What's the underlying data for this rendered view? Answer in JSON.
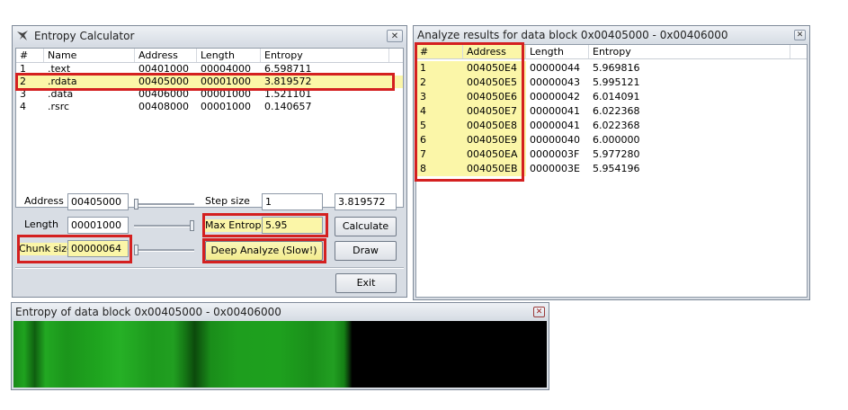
{
  "entropy_window": {
    "title": "Entropy Calculator",
    "close_label": "✕",
    "columns": [
      "#",
      "Name",
      "Address",
      "Length",
      "Entropy"
    ],
    "rows": [
      [
        "1",
        ".text",
        "00401000",
        "00004000",
        "6.598711"
      ],
      [
        "2",
        ".rdata",
        "00405000",
        "00001000",
        "3.819572"
      ],
      [
        "3",
        ".data",
        "00406000",
        "00001000",
        "1.521101"
      ],
      [
        "4",
        ".rsrc",
        "00408000",
        "00001000",
        "0.140657"
      ]
    ],
    "selected_row": 1,
    "address_label": "Address",
    "address_value": "00405000",
    "length_label": "Length",
    "length_value": "00001000",
    "chunk_label": "Chunk size",
    "chunk_value": "00000064",
    "step_label": "Step size",
    "step_value": "1",
    "result_value": "3.819572",
    "max_entropy_label": "Max Entropy",
    "max_entropy_value": "5.95",
    "calculate_label": "Calculate",
    "deep_analyze_label": "Deep Analyze (Slow!)",
    "draw_label": "Draw",
    "exit_label": "Exit"
  },
  "analyze_window": {
    "title": "Analyze results for data block 0x00405000 - 0x00406000",
    "close_label": "✕",
    "columns": [
      "#",
      "Address",
      "Length",
      "Entropy"
    ],
    "rows": [
      [
        "1",
        "004050E4",
        "00000044",
        "5.969816"
      ],
      [
        "2",
        "004050E5",
        "00000043",
        "5.995121"
      ],
      [
        "3",
        "004050E6",
        "00000042",
        "6.014091"
      ],
      [
        "4",
        "004050E7",
        "00000041",
        "6.022368"
      ],
      [
        "5",
        "004050E8",
        "00000041",
        "6.022368"
      ],
      [
        "6",
        "004050E9",
        "00000040",
        "6.000000"
      ],
      [
        "7",
        "004050EA",
        "0000003F",
        "5.977280"
      ],
      [
        "8",
        "004050EB",
        "0000003E",
        "5.954196"
      ]
    ]
  },
  "graph_window": {
    "title": "Entropy of data block 0x00405000 - 0x00406000",
    "close_label": "✕"
  },
  "colors": {
    "highlight": "#fbf6a8",
    "annotation": "#d42020",
    "graph_green": "#1fa31f",
    "graph_black": "#000000"
  }
}
